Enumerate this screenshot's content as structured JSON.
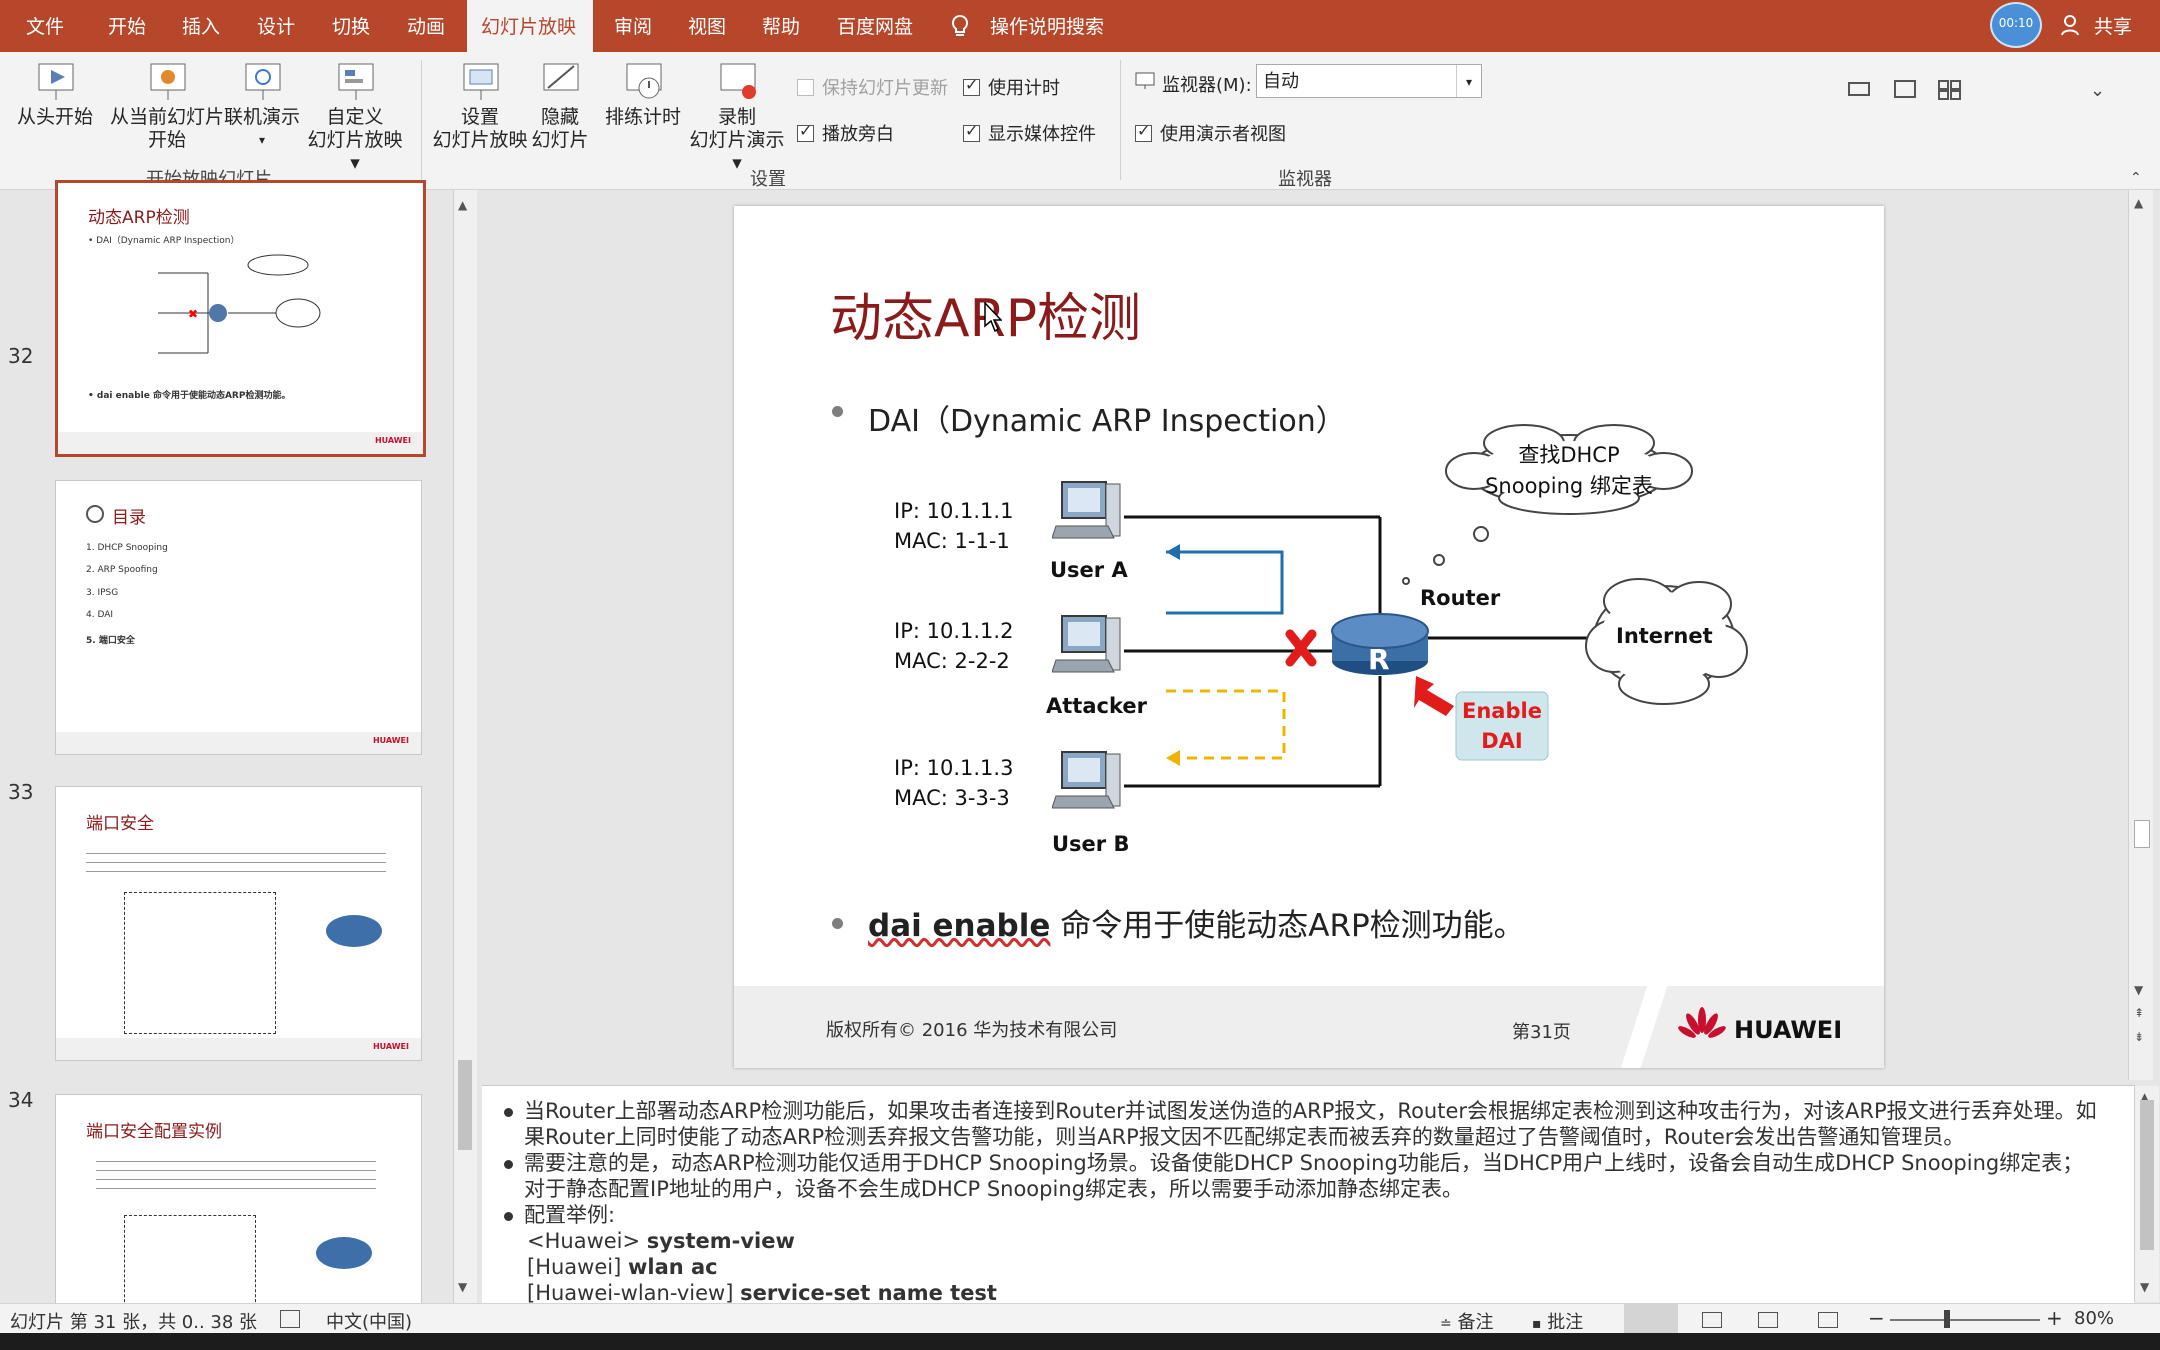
{
  "tabs": [
    "文件",
    "开始",
    "插入",
    "设计",
    "切换",
    "动画",
    "幻灯片放映",
    "审阅",
    "视图",
    "帮助",
    "百度网盘"
  ],
  "tell_me": "操作说明搜索",
  "share": "共享",
  "timer_badge": "00:10",
  "ribbon": {
    "from_start": "从头开始",
    "from_current_1": "从当前幻灯片",
    "from_current_2": "开始",
    "online_present": "联机演示",
    "custom_1": "自定义",
    "custom_2": "幻灯片放映",
    "group_start": "开始放映幻灯片",
    "setup_1": "设置",
    "setup_2": "幻灯片放映",
    "hide_1": "隐藏",
    "hide_2": "幻灯片",
    "rehearse": "排练计时",
    "record_1": "录制",
    "record_2": "幻灯片演示",
    "keep_updated": "保持幻灯片更新",
    "play_narrations": "播放旁白",
    "use_timings": "使用计时",
    "show_media": "显示媒体控件",
    "group_setup": "设置",
    "monitor_label": "监视器(M):",
    "monitor_value": "自动",
    "presenter_view": "使用演示者视图",
    "group_monitor": "监视器"
  },
  "thumbnails": [
    {
      "num": "",
      "title": "动态ARP检测"
    },
    {
      "num": "32",
      "title": "目录",
      "items": [
        "1.  DHCP Snooping",
        "2.  ARP Spoofing",
        "3.  IPSG",
        "4.  DAI",
        "5.  端口安全"
      ]
    },
    {
      "num": "33",
      "title": "端口安全"
    },
    {
      "num": "34",
      "title": "端口安全配置实例"
    }
  ],
  "slide": {
    "title": "动态ARP检测",
    "bullet1": "DAI（Dynamic ARP Inspection）",
    "cloud_line1": "查找DHCP",
    "cloud_line2": "Snooping 绑定表",
    "ua_ip": "IP: 10.1.1.1",
    "ua_mac": "MAC: 1-1-1",
    "ua_name": "User A",
    "at_ip": "IP: 10.1.1.2",
    "at_mac": "MAC: 2-2-2",
    "at_name": "Attacker",
    "ub_ip": "IP: 10.1.1.3",
    "ub_mac": "MAC: 3-3-3",
    "ub_name": "User B",
    "router": "Router",
    "internet": "Internet",
    "enable1": "Enable",
    "enable2": "DAI",
    "bullet2_bold": "dai enable",
    "bullet2_rest": " 命令用于使能动态ARP检测功能。",
    "copyright": "版权所有© 2016 华为技术有限公司",
    "page": "第31页",
    "brand": "HUAWEI"
  },
  "notes": {
    "p1": "当Router上部署动态ARP检测功能后，如果攻击者连接到Router并试图发送伪造的ARP报文，Router会根据绑定表检测到这种攻击行为，对该ARP报文进行丢弃处理。如果Router上同时使能了动态ARP检测丢弃报文告警功能，则当ARP报文因不匹配绑定表而被丢弃的数量超过了告警阈值时，Router会发出告警通知管理员。",
    "p2": "需要注意的是，动态ARP检测功能仅适用于DHCP Snooping场景。设备使能DHCP Snooping功能后，当DHCP用户上线时，设备会自动生成DHCP Snooping绑定表；对于静态配置IP地址的用户，设备不会生成DHCP Snooping绑定表，所以需要手动添加静态绑定表。",
    "p3": "配置举例:",
    "c1a": "<Huawei> ",
    "c1b": "system-view",
    "c2a": "[Huawei] ",
    "c2b": "wlan ac",
    "c3a": "[Huawei-wlan-view] ",
    "c3b": "service-set name test"
  },
  "status": {
    "slide_info": "幻灯片 第 31 张，共 0.. 38 张",
    "language": "中文(中国)",
    "notes_btn": "备注",
    "comments_btn": "批注",
    "zoom": "80%"
  },
  "colors": {
    "accent": "#b7472a",
    "title_red": "#8b1a1a"
  }
}
